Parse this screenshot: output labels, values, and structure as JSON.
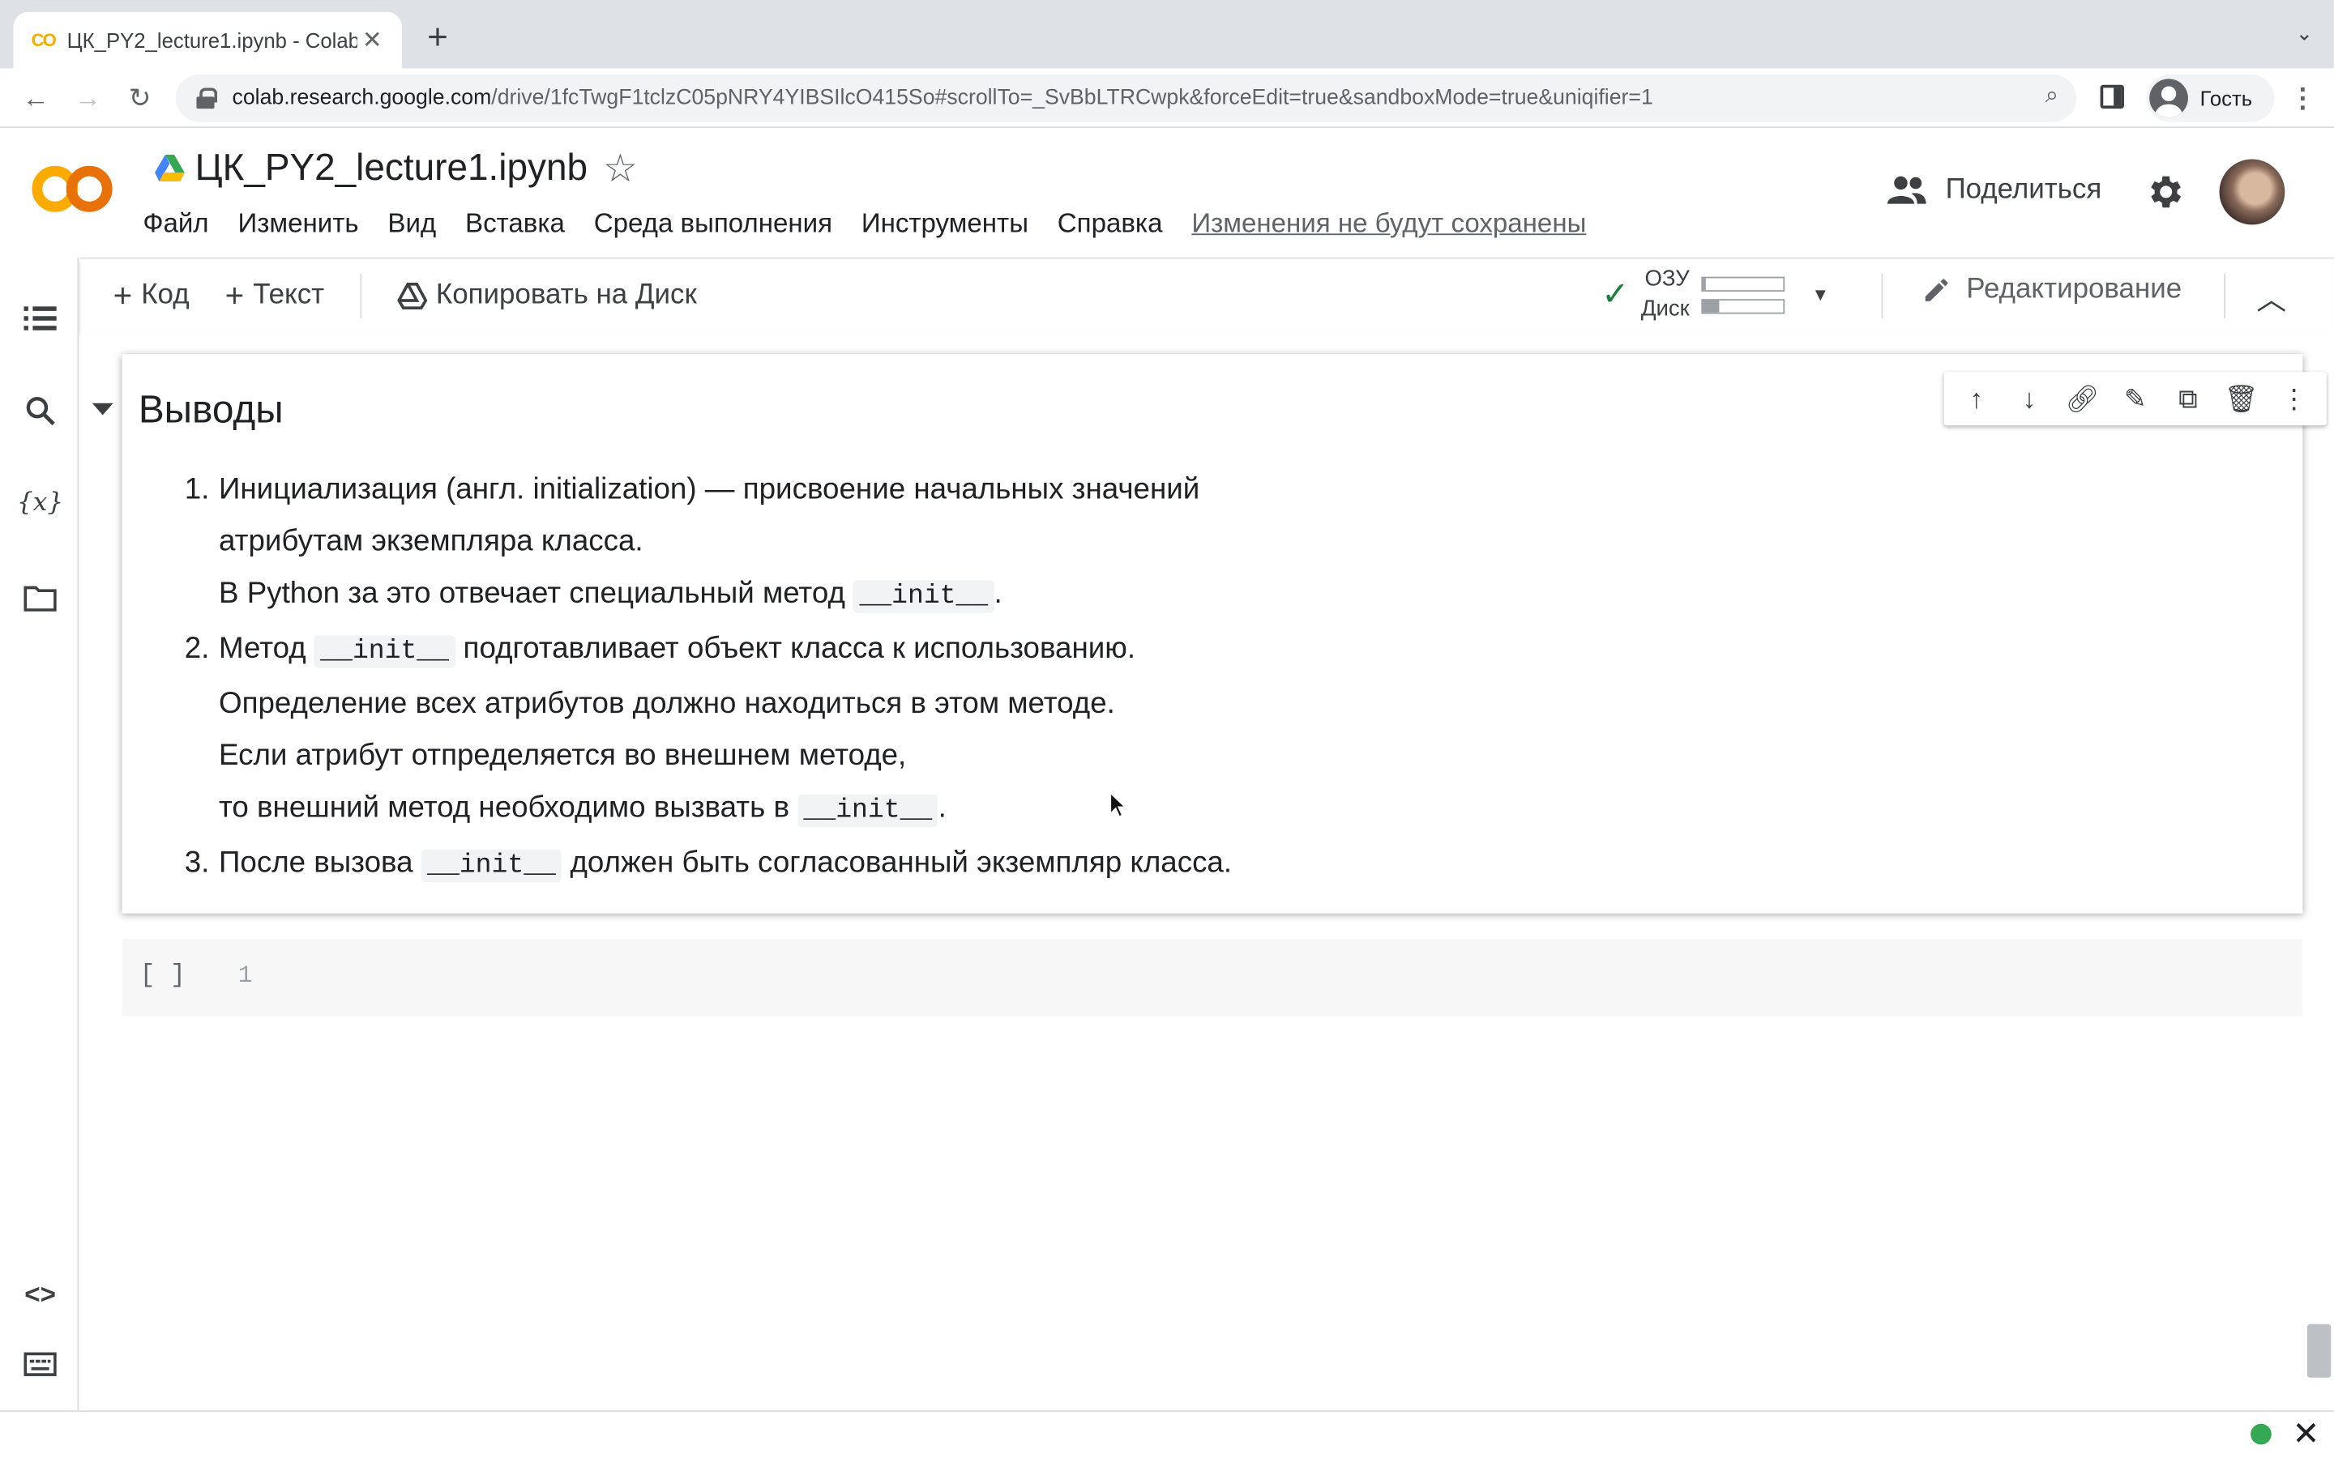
{
  "browser": {
    "tab_title": "ЦК_PY2_lecture1.ipynb - Colab",
    "tab_favicon": "CO",
    "url_host": "colab.research.google.com",
    "url_path": "/drive/1fcTwgF1tclzC05pNRY4YIBSIlcO415So#scrollTo=_SvBbLTRCwpk&forceEdit=true&sandboxMode=true&uniqifier=1",
    "profile_label": "Гость"
  },
  "header": {
    "notebook_title": "ЦК_PY2_lecture1.ipynb",
    "menu": [
      "Файл",
      "Изменить",
      "Вид",
      "Вставка",
      "Среда выполнения",
      "Инструменты",
      "Справка"
    ],
    "unsaved_notice": "Изменения не будут сохранены",
    "share_label": "Поделиться"
  },
  "toolbar": {
    "add_code": "Код",
    "add_text": "Текст",
    "copy_to_drive": "Копировать на Диск",
    "ram_label": "ОЗУ",
    "disk_label": "Диск",
    "ram_fraction": 0.04,
    "disk_fraction": 0.2,
    "edit_mode": "Редактирование"
  },
  "text_cell": {
    "heading": "Выводы",
    "items": [
      {
        "num": "1.",
        "lines": [
          "Инициализация (англ. initialization) — присвоение начальных значений",
          "атрибутам экземпляра класса.",
          "В Python за это отвечает специальный метод"
        ]
      },
      {
        "num": "2.",
        "lines": [
          "Метод",
          "подготавливает объект класса к использованию.",
          "Определение всех атрибутов должно находиться в этом методе.",
          "Если атрибут отпределяется во внешнем методе,",
          "то внешний метод необходимо вызвать в"
        ]
      },
      {
        "num": "3.",
        "lines": [
          "После вызова",
          "должен быть согласованный экземпляр класса."
        ]
      }
    ],
    "code_token": "__init__"
  },
  "code_cell": {
    "bracket": "[ ]",
    "line_number": "1"
  },
  "colors": {
    "accent_orange": "#f9ab00",
    "status_green": "#34a853",
    "check_green": "#188038"
  }
}
